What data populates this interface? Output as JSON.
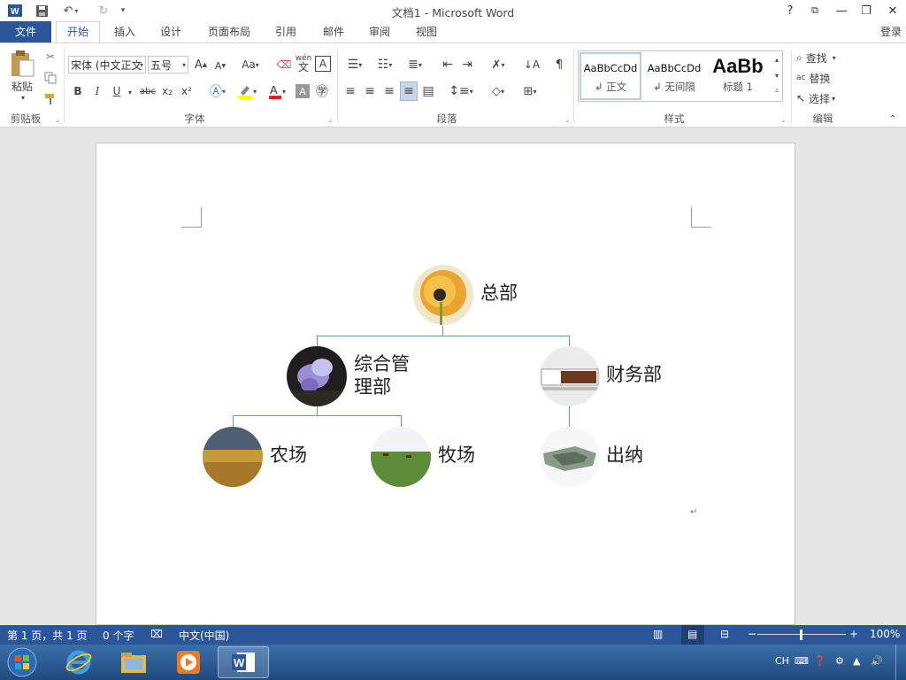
{
  "window": {
    "title": "文档1 - Microsoft Word",
    "signin": "登录",
    "controls": [
      "?",
      "⧉",
      "—",
      "❐",
      "✕"
    ]
  },
  "tabs": [
    {
      "label": "文件"
    },
    {
      "label": "开始"
    },
    {
      "label": "插入"
    },
    {
      "label": "设计"
    },
    {
      "label": "页面布局"
    },
    {
      "label": "引用"
    },
    {
      "label": "邮件"
    },
    {
      "label": "审阅"
    },
    {
      "label": "视图"
    }
  ],
  "ribbon": {
    "clipboard": {
      "group": "剪贴板",
      "paste": "粘贴"
    },
    "font": {
      "group": "字体",
      "font_name": "宋体 (中文正文",
      "font_size": "五号",
      "change_case": "Aa",
      "bold": "B",
      "italic": "I",
      "underline": "U",
      "strike": "abc",
      "sub": "x₂",
      "sup": "x²",
      "phonetic": "wén",
      "phonetic2": "文",
      "border_char": "A"
    },
    "paragraph": {
      "group": "段落"
    },
    "styles": {
      "group": "样式",
      "items": [
        {
          "preview": "AaBbCcDd",
          "name": "正文"
        },
        {
          "preview": "AaBbCcDd",
          "name": "无间隔"
        },
        {
          "preview": "AaBb",
          "name": "标题 1"
        }
      ]
    },
    "editing": {
      "group": "编辑",
      "find": "查找",
      "replace": "替换",
      "select": "选择"
    }
  },
  "org_chart": {
    "nodes": {
      "root": "总部",
      "mid_left": "综合管理部",
      "mid_left_l1": "综合管",
      "mid_left_l2": "理部",
      "mid_right": "财务部",
      "leaf1": "农场",
      "leaf2": "牧场",
      "leaf3": "出纳"
    }
  },
  "statusbar": {
    "page": "第 1 页，共 1 页",
    "words": "0 个字",
    "language": "中文(中国)",
    "zoom": "100%",
    "zoom_minus": "−",
    "zoom_plus": "+"
  },
  "taskbar": {
    "ime": "CH"
  },
  "colors": {
    "accent": "#2b579a",
    "connector": "#5b9bbf"
  }
}
